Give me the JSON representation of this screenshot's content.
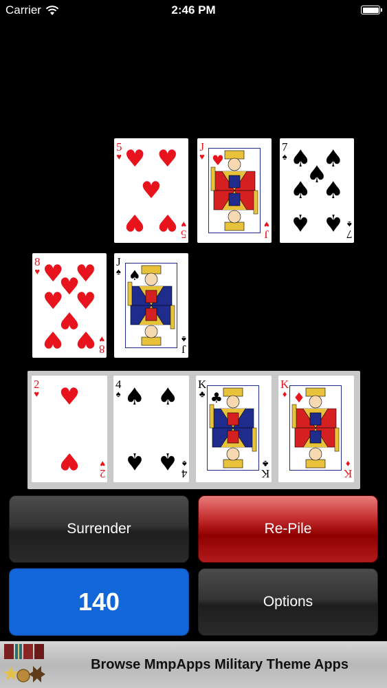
{
  "status_bar": {
    "carrier": "Carrier",
    "time": "2:46 PM",
    "icons": [
      "wifi-icon",
      "battery-icon"
    ]
  },
  "colors": {
    "background": "#000000",
    "card_red": "#e8141d",
    "card_black": "#000000",
    "repile_button": "#a60f0f",
    "score_button": "#1266d8",
    "hand_area": "#c9c9c9"
  },
  "table": {
    "row1": [
      {
        "rank": "5",
        "suit": "♥",
        "color": "red",
        "type": "pip5"
      },
      {
        "rank": "J",
        "suit": "♥",
        "color": "red",
        "type": "face"
      },
      {
        "rank": "7",
        "suit": "♠",
        "color": "black",
        "type": "pip7"
      }
    ],
    "row2": [
      {
        "rank": "8",
        "suit": "♥",
        "color": "red",
        "type": "pip8"
      },
      {
        "rank": "J",
        "suit": "♠",
        "color": "black",
        "type": "face"
      }
    ]
  },
  "hand": [
    {
      "rank": "2",
      "suit": "♥",
      "color": "red",
      "type": "pip2"
    },
    {
      "rank": "4",
      "suit": "♠",
      "color": "black",
      "type": "pip4"
    },
    {
      "rank": "K",
      "suit": "♣",
      "color": "black",
      "type": "face"
    },
    {
      "rank": "K",
      "suit": "♦",
      "color": "red",
      "type": "face"
    }
  ],
  "controls": {
    "surrender_label": "Surrender",
    "repile_label": "Re-Pile",
    "score": "140",
    "options_label": "Options"
  },
  "ad": {
    "text": "Browse MmpApps Military Theme Apps",
    "icon": "medals-icon"
  }
}
